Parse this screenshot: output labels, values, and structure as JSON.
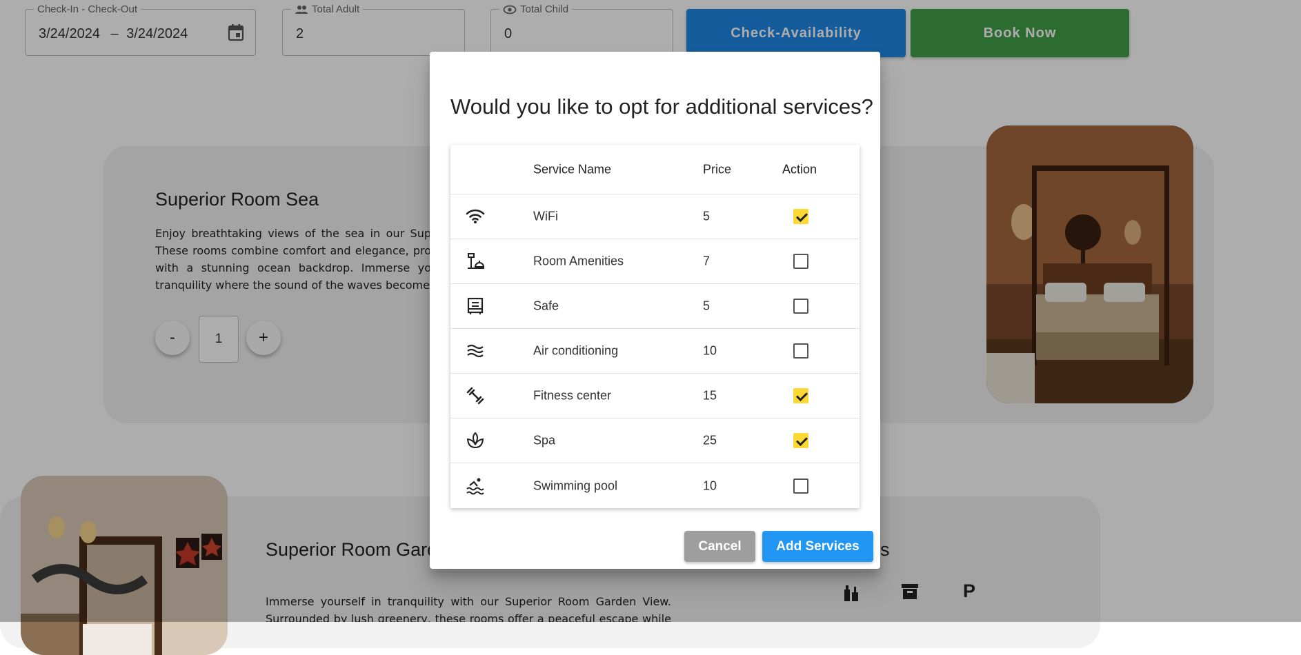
{
  "booking_bar": {
    "dates": {
      "label": "Check-In - Check-Out",
      "check_in": "3/24/2024",
      "separator": "–",
      "check_out": "3/24/2024"
    },
    "adults": {
      "label": "Total Adult",
      "value": "2"
    },
    "children": {
      "label": "Total Child",
      "value": "0"
    },
    "check_availability_label": "Check-Availability",
    "book_now_label": "Book Now"
  },
  "rooms": [
    {
      "title": "Superior Room Sea",
      "description": "Enjoy breathtaking views of the sea in our Sup These rooms combine comfort and elegance, pro with a stunning ocean backdrop. Immerse yo tranquility where the sound of the waves become",
      "minus_label": "-",
      "quantity": "1",
      "plus_label": "+"
    },
    {
      "title": "Superior Room Gard",
      "description": "Immerse yourself in tranquility with our Superior Room Garden View. Surrounded by lush greenery, these rooms offer a peaceful escape while maintaining a touch of sophistication. Revel in the beauty of",
      "amenities_heading_tail": "s",
      "parking_label": "P"
    }
  ],
  "dialog": {
    "title": "Would you like to opt for additional services?",
    "columns": {
      "icon": "",
      "name": "Service Name",
      "price": "Price",
      "action": "Action"
    },
    "services": [
      {
        "icon": "wifi-icon",
        "name": "WiFi",
        "price": "5",
        "checked": true
      },
      {
        "icon": "room-amenities-icon",
        "name": "Room Amenities",
        "price": "7",
        "checked": false
      },
      {
        "icon": "safe-icon",
        "name": "Safe",
        "price": "5",
        "checked": false
      },
      {
        "icon": "air-conditioning-icon",
        "name": "Air conditioning",
        "price": "10",
        "checked": false
      },
      {
        "icon": "fitness-icon",
        "name": "Fitness center",
        "price": "15",
        "checked": true
      },
      {
        "icon": "spa-icon",
        "name": "Spa",
        "price": "25",
        "checked": true
      },
      {
        "icon": "swimming-pool-icon",
        "name": "Swimming pool",
        "price": "10",
        "checked": false
      }
    ],
    "cancel_label": "Cancel",
    "add_label": "Add Services"
  },
  "colors": {
    "primary_blue": "#1e88e5",
    "green": "#43a047",
    "checkbox_yellow": "#fdd835",
    "cancel_grey": "#9e9e9e",
    "add_blue": "#2196f3"
  }
}
